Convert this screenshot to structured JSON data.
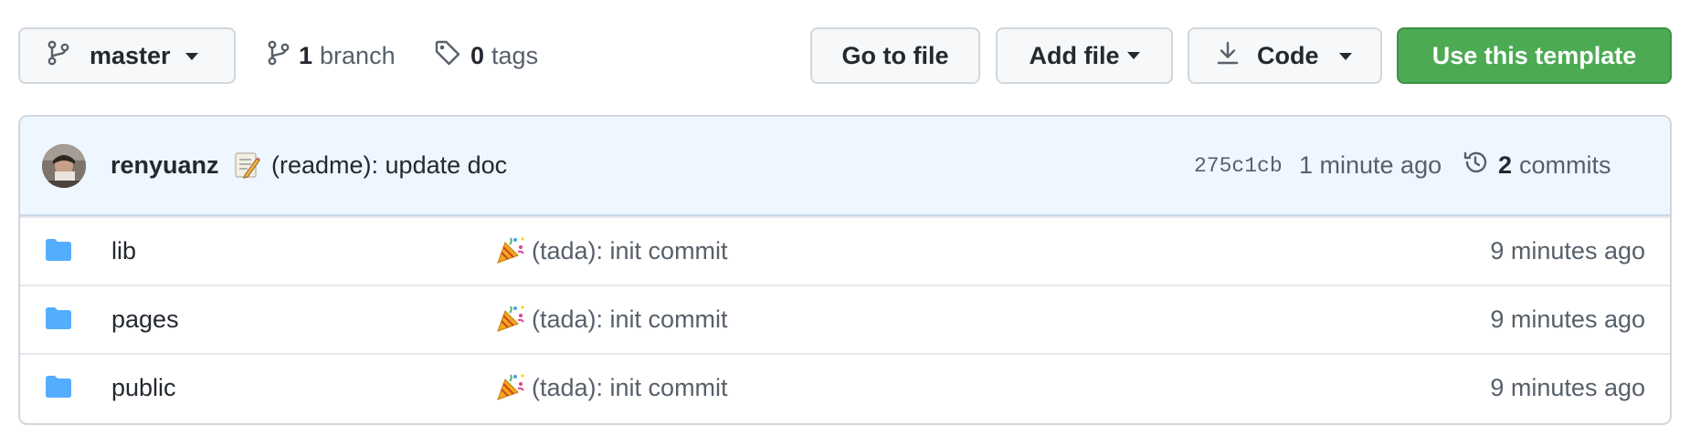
{
  "toolbar": {
    "branch_button": {
      "label": "master",
      "icon": "git-branch-icon"
    },
    "branches": {
      "count": "1",
      "label": "branch",
      "icon": "git-branch-icon"
    },
    "tags": {
      "count": "0",
      "label": "tags",
      "icon": "tag-icon"
    },
    "go_to_file_label": "Go to file",
    "add_file_label": "Add file",
    "code_label": "Code",
    "code_icon": "download-icon",
    "use_template_label": "Use this template"
  },
  "latest_commit": {
    "author": "renyuanz",
    "emoji": "memo-emoji",
    "message": "(readme): update doc",
    "sha": "275c1cb",
    "time": "1 minute ago",
    "commit_count": "2",
    "commits_label": "commits",
    "history_icon": "history-icon"
  },
  "files": [
    {
      "name": "lib",
      "type": "folder",
      "message": "(tada): init commit",
      "emoji": "tada-emoji",
      "time": "9 minutes ago"
    },
    {
      "name": "pages",
      "type": "folder",
      "message": "(tada): init commit",
      "emoji": "tada-emoji",
      "time": "9 minutes ago"
    },
    {
      "name": "public",
      "type": "folder",
      "message": "(tada): init commit",
      "emoji": "tada-emoji",
      "time": "9 minutes ago"
    }
  ],
  "colors": {
    "primary_button": "#4caa53",
    "folder_icon": "#54aeff",
    "commit_header_bg": "#eef6ff",
    "muted_text": "#57606a"
  }
}
